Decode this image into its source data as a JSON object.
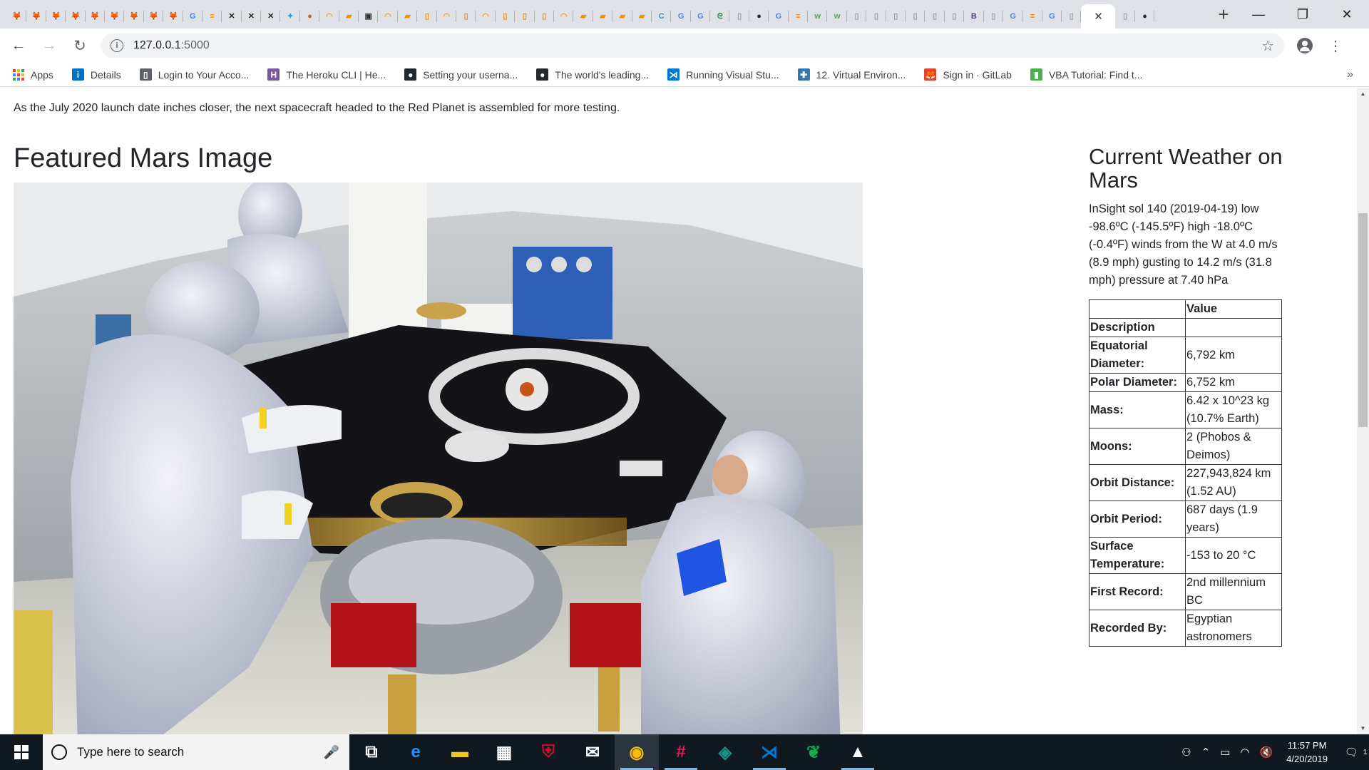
{
  "browser": {
    "tabs": [
      {
        "icon": "gitlab-icon",
        "color": "#e24329",
        "glyph": "🦊"
      },
      {
        "icon": "gitlab-icon",
        "color": "#e24329",
        "glyph": "🦊"
      },
      {
        "icon": "gitlab-icon",
        "color": "#e24329",
        "glyph": "🦊"
      },
      {
        "icon": "gitlab-icon",
        "color": "#e24329",
        "glyph": "🦊"
      },
      {
        "icon": "gitlab-icon",
        "color": "#e24329",
        "glyph": "🦊"
      },
      {
        "icon": "gitlab-icon",
        "color": "#e24329",
        "glyph": "🦊"
      },
      {
        "icon": "gitlab-icon",
        "color": "#e24329",
        "glyph": "🦊"
      },
      {
        "icon": "gitlab-icon",
        "color": "#e24329",
        "glyph": "🦊"
      },
      {
        "icon": "gitlab-icon",
        "color": "#e24329",
        "glyph": "🦊"
      },
      {
        "icon": "google-icon",
        "color": "#4285f4",
        "glyph": "G"
      },
      {
        "icon": "stackoverflow-icon",
        "color": "#f48024",
        "glyph": "≡"
      },
      {
        "icon": "nasa-icon",
        "color": "#222222",
        "glyph": "✕"
      },
      {
        "icon": "nasa-icon",
        "color": "#222222",
        "glyph": "✕"
      },
      {
        "icon": "nasa-icon",
        "color": "#222222",
        "glyph": "✕"
      },
      {
        "icon": "twitter-icon",
        "color": "#1da1f2",
        "glyph": "✦"
      },
      {
        "icon": "mars-icon",
        "color": "#b5651d",
        "glyph": "●"
      },
      {
        "icon": "amazon-icon",
        "color": "#ff9900",
        "glyph": "◠"
      },
      {
        "icon": "coursera-icon",
        "color": "#f29100",
        "glyph": "▰"
      },
      {
        "icon": "jupyter-icon",
        "color": "#333333",
        "glyph": "▣"
      },
      {
        "icon": "amazon-icon",
        "color": "#ff9900",
        "glyph": "◠"
      },
      {
        "icon": "coursera-icon",
        "color": "#f29100",
        "glyph": "▰"
      },
      {
        "icon": "document-icon",
        "color": "#f29100",
        "glyph": "▯"
      },
      {
        "icon": "amazon-icon",
        "color": "#ff9900",
        "glyph": "◠"
      },
      {
        "icon": "document-icon",
        "color": "#f29100",
        "glyph": "▯"
      },
      {
        "icon": "amazon-icon",
        "color": "#ff9900",
        "glyph": "◠"
      },
      {
        "icon": "document-icon",
        "color": "#f29100",
        "glyph": "▯"
      },
      {
        "icon": "document-icon",
        "color": "#f29100",
        "glyph": "▯"
      },
      {
        "icon": "document-icon",
        "color": "#f29100",
        "glyph": "▯"
      },
      {
        "icon": "amazon-icon",
        "color": "#ff9900",
        "glyph": "◠"
      },
      {
        "icon": "coursera-icon",
        "color": "#f29100",
        "glyph": "▰"
      },
      {
        "icon": "coursera-icon",
        "color": "#f29100",
        "glyph": "▰"
      },
      {
        "icon": "coursera-icon",
        "color": "#f29100",
        "glyph": "▰"
      },
      {
        "icon": "coursera-icon",
        "color": "#f29100",
        "glyph": "▰"
      },
      {
        "icon": "c-icon",
        "color": "#3c8dbc",
        "glyph": "C"
      },
      {
        "icon": "google-icon",
        "color": "#4285f4",
        "glyph": "G"
      },
      {
        "icon": "google-icon",
        "color": "#4285f4",
        "glyph": "G"
      },
      {
        "icon": "geeksforgeeks-icon",
        "color": "#2f8d46",
        "glyph": "ᘓ"
      },
      {
        "icon": "document-icon",
        "color": "#9aa0a6",
        "glyph": "▯"
      },
      {
        "icon": "github-icon",
        "color": "#24292e",
        "glyph": "●"
      },
      {
        "icon": "google-icon",
        "color": "#4285f4",
        "glyph": "G"
      },
      {
        "icon": "stackoverflow-icon",
        "color": "#f48024",
        "glyph": "≡"
      },
      {
        "icon": "w3schools-icon",
        "color": "#4caf50",
        "glyph": "w"
      },
      {
        "icon": "w3schools-icon",
        "color": "#4caf50",
        "glyph": "w"
      },
      {
        "icon": "document-icon",
        "color": "#9aa0a6",
        "glyph": "▯"
      },
      {
        "icon": "document-icon",
        "color": "#9aa0a6",
        "glyph": "▯"
      },
      {
        "icon": "document-icon",
        "color": "#9aa0a6",
        "glyph": "▯"
      },
      {
        "icon": "document-icon",
        "color": "#9aa0a6",
        "glyph": "▯"
      },
      {
        "icon": "document-icon",
        "color": "#9aa0a6",
        "glyph": "▯"
      },
      {
        "icon": "document-icon",
        "color": "#9aa0a6",
        "glyph": "▯"
      },
      {
        "icon": "bootstrap-icon",
        "color": "#563d7c",
        "glyph": "B"
      },
      {
        "icon": "document-icon",
        "color": "#9aa0a6",
        "glyph": "▯"
      },
      {
        "icon": "google-icon",
        "color": "#4285f4",
        "glyph": "G"
      },
      {
        "icon": "stackoverflow-icon",
        "color": "#f48024",
        "glyph": "≡"
      },
      {
        "icon": "google-icon",
        "color": "#4285f4",
        "glyph": "G"
      },
      {
        "icon": "document-icon",
        "color": "#9aa0a6",
        "glyph": "▯"
      }
    ],
    "active_tab_close": "✕",
    "after_tabs": [
      {
        "icon": "document-icon",
        "color": "#9aa0a6",
        "glyph": "▯"
      },
      {
        "icon": "github-icon",
        "color": "#24292e",
        "glyph": "●"
      }
    ],
    "new_tab": "+",
    "window_controls": {
      "minimize": "—",
      "restore": "❐",
      "close": "✕"
    },
    "nav": {
      "back": "←",
      "forward": "→",
      "reload": "↻"
    },
    "url_host": "127.0.0.1",
    "url_port": ":5000",
    "info_glyph": "i",
    "star": "☆",
    "menu": "⋮",
    "bookmarks": [
      {
        "label": "Apps",
        "icon": "apps-icon",
        "color": "#4285f4",
        "glyph": ""
      },
      {
        "label": "Details",
        "icon": "intel-icon",
        "color": "#0071c5",
        "glyph": "i"
      },
      {
        "label": "Login to Your Acco...",
        "icon": "page-icon",
        "color": "#5f6368",
        "glyph": "▯"
      },
      {
        "label": "The Heroku CLI | He...",
        "icon": "heroku-icon",
        "color": "#79589f",
        "glyph": "H"
      },
      {
        "label": "Setting your userna...",
        "icon": "github-icon",
        "color": "#24292e",
        "glyph": "●"
      },
      {
        "label": "The world's leading...",
        "icon": "github-icon",
        "color": "#24292e",
        "glyph": "●"
      },
      {
        "label": "Running Visual Stu...",
        "icon": "vscode-icon",
        "color": "#007acc",
        "glyph": "⋊"
      },
      {
        "label": "12. Virtual Environ...",
        "icon": "python-icon",
        "color": "#3776ab",
        "glyph": "✚"
      },
      {
        "label": "Sign in · GitLab",
        "icon": "gitlab-icon",
        "color": "#e24329",
        "glyph": "🦊"
      },
      {
        "label": "VBA Tutorial: Find t...",
        "icon": "chart-icon",
        "color": "#4caf50",
        "glyph": "▮"
      }
    ],
    "bookmarks_more": "»"
  },
  "page": {
    "teaser": "As the July 2020 launch date inches closer, the next spacecraft headed to the Red Planet is assembled for more testing.",
    "featured_title": "Featured Mars Image",
    "weather_title": "Current Weather on Mars",
    "weather_text": "InSight sol 140 (2019-04-19) low -98.6ºC (-145.5ºF) high -18.0ºC (-0.4ºF) winds from the W at 4.0 m/s (8.9 mph) gusting to 14.2 m/s (31.8 mph) pressure at 7.40 hPa",
    "facts_header": {
      "col1": "",
      "col2": "Value"
    },
    "facts": [
      {
        "label": "Description",
        "value": ""
      },
      {
        "label": "Equatorial Diameter:",
        "value": "6,792 km"
      },
      {
        "label": "Polar Diameter:",
        "value": "6,752 km"
      },
      {
        "label": "Mass:",
        "value": "6.42 x 10^23 kg (10.7% Earth)"
      },
      {
        "label": "Moons:",
        "value": "2 (Phobos & Deimos)"
      },
      {
        "label": "Orbit Distance:",
        "value": "227,943,824 km (1.52 AU)"
      },
      {
        "label": "Orbit Period:",
        "value": "687 days (1.9 years)"
      },
      {
        "label": "Surface Temperature:",
        "value": "-153 to 20 °C"
      },
      {
        "label": "First Record:",
        "value": "2nd millennium BC"
      },
      {
        "label": "Recorded By:",
        "value": "Egyptian astronomers"
      }
    ]
  },
  "taskbar": {
    "search_placeholder": "Type here to search",
    "mic": "🎤",
    "apps": [
      {
        "icon": "task-view-icon",
        "color": "#ffffff",
        "glyph": "⧉",
        "state": ""
      },
      {
        "icon": "edge-icon",
        "color": "#1e90ff",
        "glyph": "e",
        "state": ""
      },
      {
        "icon": "file-explorer-icon",
        "color": "#f5c518",
        "glyph": "▬",
        "state": ""
      },
      {
        "icon": "store-icon",
        "color": "#ffffff",
        "glyph": "▦",
        "state": ""
      },
      {
        "icon": "mcafee-icon",
        "color": "#c8102e",
        "glyph": "⛨",
        "state": ""
      },
      {
        "icon": "mail-icon",
        "color": "#ffffff",
        "glyph": "✉",
        "state": ""
      },
      {
        "icon": "chrome-icon",
        "color": "#fbbc05",
        "glyph": "◉",
        "state": "active"
      },
      {
        "icon": "slack-icon",
        "color": "#e01e5a",
        "glyph": "#",
        "state": "open"
      },
      {
        "icon": "gitkraken-icon",
        "color": "#179287",
        "glyph": "◈",
        "state": ""
      },
      {
        "icon": "vscode-icon",
        "color": "#007acc",
        "glyph": "⋊",
        "state": "open"
      },
      {
        "icon": "mongodb-icon",
        "color": "#13aa52",
        "glyph": "❦",
        "state": ""
      },
      {
        "icon": "photos-icon",
        "color": "#ffffff",
        "glyph": "▲",
        "state": "open"
      }
    ],
    "tray": {
      "people": "⚇",
      "chevron": "⌃",
      "battery": "▭",
      "wifi": "◠",
      "volume": "🔇"
    },
    "time": "11:57 PM",
    "date": "4/20/2019",
    "notification_count": "1"
  }
}
